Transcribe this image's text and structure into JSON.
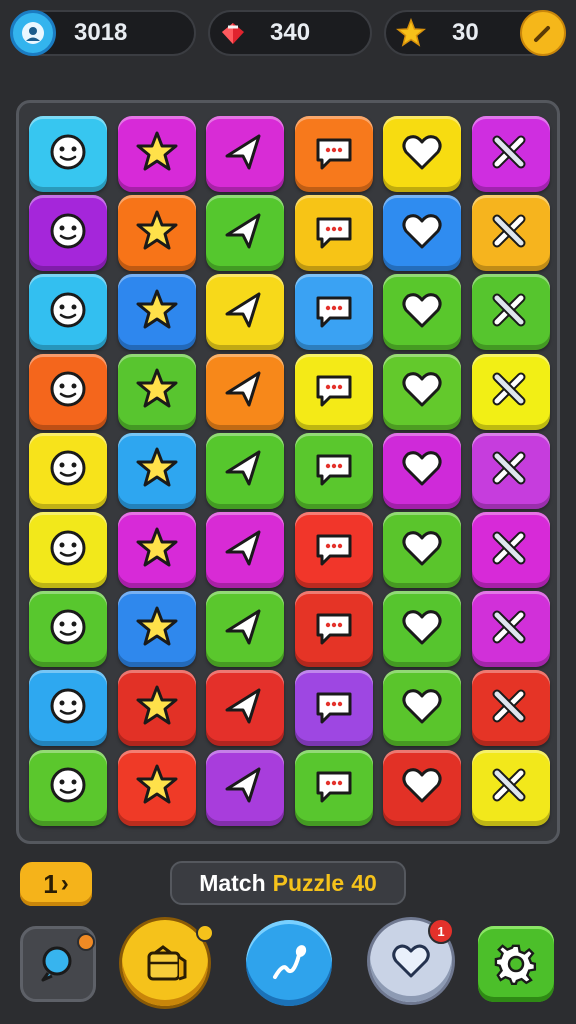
{
  "hud": {
    "profile_value": "3018",
    "gems_value": "340",
    "stars_value": "30"
  },
  "board": {
    "columns": 6,
    "rows": 9,
    "tiles": [
      [
        "#37c6f0",
        "paper-plane-icon"
      ],
      [
        "#d72ad8",
        "crossed-arrows-icon"
      ],
      [
        "#d82cd6",
        "speech-bubble-icon"
      ],
      [
        "#f7791c",
        "ghost-icon"
      ],
      [
        "#f7dc11",
        "slime-icon"
      ],
      [
        "#cf2ee0",
        "chat-bubble-icon"
      ],
      [
        "#a526da",
        "star-icon"
      ],
      [
        "#f77418",
        "water-drop-icon"
      ],
      [
        "#55c72e",
        "gear-face-icon"
      ],
      [
        "#f7c416",
        "planet-icon"
      ],
      [
        "#2f8cf0",
        "magnifier-icon"
      ],
      [
        "#f6b41e",
        "fish-icon"
      ],
      [
        "#33bff0",
        "bear-icon"
      ],
      [
        "#2e87ee",
        "snowball-icon"
      ],
      [
        "#f7d91a",
        "crossed-tools-icon"
      ],
      [
        "#3aa2f3",
        "crossed-swords-icon"
      ],
      [
        "#59c72c",
        "robot-face-icon"
      ],
      [
        "#56c52e",
        "crab-icon"
      ],
      [
        "#f4661c",
        "smiley-icon"
      ],
      [
        "#58c52f",
        "calculator-icon"
      ],
      [
        "#f7881a",
        "smiley-orange-icon"
      ],
      [
        "#f4ea17",
        "pencil-icon"
      ],
      [
        "#63c92c",
        "rocket-icon"
      ],
      [
        "#f2ef15",
        "heart-cloud-icon"
      ],
      [
        "#f7e31b",
        "envelope-icon"
      ],
      [
        "#2ea6f0",
        "sun-face-icon"
      ],
      [
        "#56c72d",
        "phone-icon"
      ],
      [
        "#5ac72d",
        "pen-icon"
      ],
      [
        "#cf2ad9",
        "message-icon"
      ],
      [
        "#c63ddd",
        "send-icon"
      ],
      [
        "#f2e81b",
        "leaf-icon"
      ],
      [
        "#d72ad8",
        "mail-icon"
      ],
      [
        "#d82bd5",
        "wand-star-icon"
      ],
      [
        "#f1362a",
        "brush-icon"
      ],
      [
        "#5ac52c",
        "lollipop-icon"
      ],
      [
        "#d72ad8",
        "balloon-icon"
      ],
      [
        "#58c72e",
        "bandage-icon"
      ],
      [
        "#2f88ed",
        "heart-icon"
      ],
      [
        "#5ac72d",
        "chat-icon"
      ],
      [
        "#e53426",
        "rocket-white-icon"
      ],
      [
        "#56c52e",
        "star-badge-icon"
      ],
      [
        "#d130d9",
        "arrow-cursor-icon"
      ],
      [
        "#2ea8f0",
        "star-arrow-icon"
      ],
      [
        "#e23126",
        "key-tool-icon"
      ],
      [
        "#e4302a",
        "flower-gear-icon"
      ],
      [
        "#9e47e2",
        "star-cloud-icon"
      ],
      [
        "#5ac52c",
        "pile-icon"
      ],
      [
        "#e53426",
        "blob-face-icon"
      ],
      [
        "#5bc72d",
        "capsule-icon"
      ],
      [
        "#ef3a27",
        "paper-icon"
      ],
      [
        "#a83ddc",
        "bone-wrench-icon"
      ],
      [
        "#58c62e",
        "cookie-face-icon"
      ],
      [
        "#e23126",
        "device-icon"
      ],
      [
        "#f2e81b",
        "gloved-hand-icon"
      ]
    ]
  },
  "footer": {
    "level_number": "1",
    "level_chevron": "›",
    "title_word1": "Match",
    "title_word2": "Puzzle",
    "title_number": "40",
    "heart_badge": "1"
  },
  "colors": {
    "background": "#2c2d30",
    "accent_yellow": "#f5c21b",
    "accent_blue": "#37b4ee",
    "accent_red": "#e3312b"
  }
}
